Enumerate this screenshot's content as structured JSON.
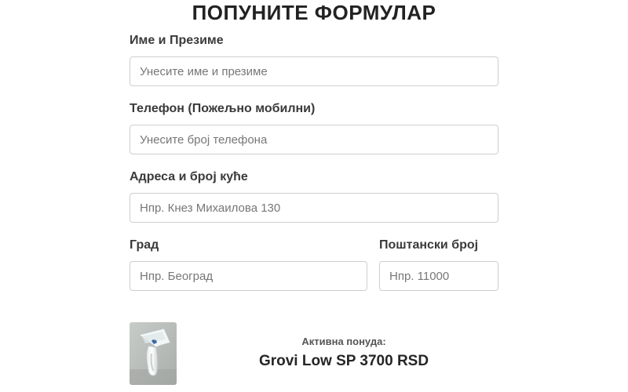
{
  "form": {
    "title": "ПОПУНИТЕ ФОРМУЛАР",
    "name": {
      "label": "Име и Презиме",
      "placeholder": "Унесите име и презиме",
      "value": ""
    },
    "phone": {
      "label": "Телефон (Пожељно мобилни)",
      "placeholder": "Унесите број телефона",
      "value": ""
    },
    "address": {
      "label": "Адреса и број куће",
      "placeholder": "Нпр. Кнез Михаилова 130",
      "value": ""
    },
    "city": {
      "label": "Град",
      "placeholder": "Нпр. Београд",
      "value": ""
    },
    "postal": {
      "label": "Поштански број",
      "placeholder": "Нпр. 11000",
      "value": ""
    }
  },
  "offer": {
    "label": "Активна понуда:",
    "text": "Grovi Low SP 3700 RSD",
    "product_icon": "epilator-product-image"
  },
  "colors": {
    "border": "#cfcfcf",
    "text": "#333333",
    "placeholder": "#777777"
  }
}
